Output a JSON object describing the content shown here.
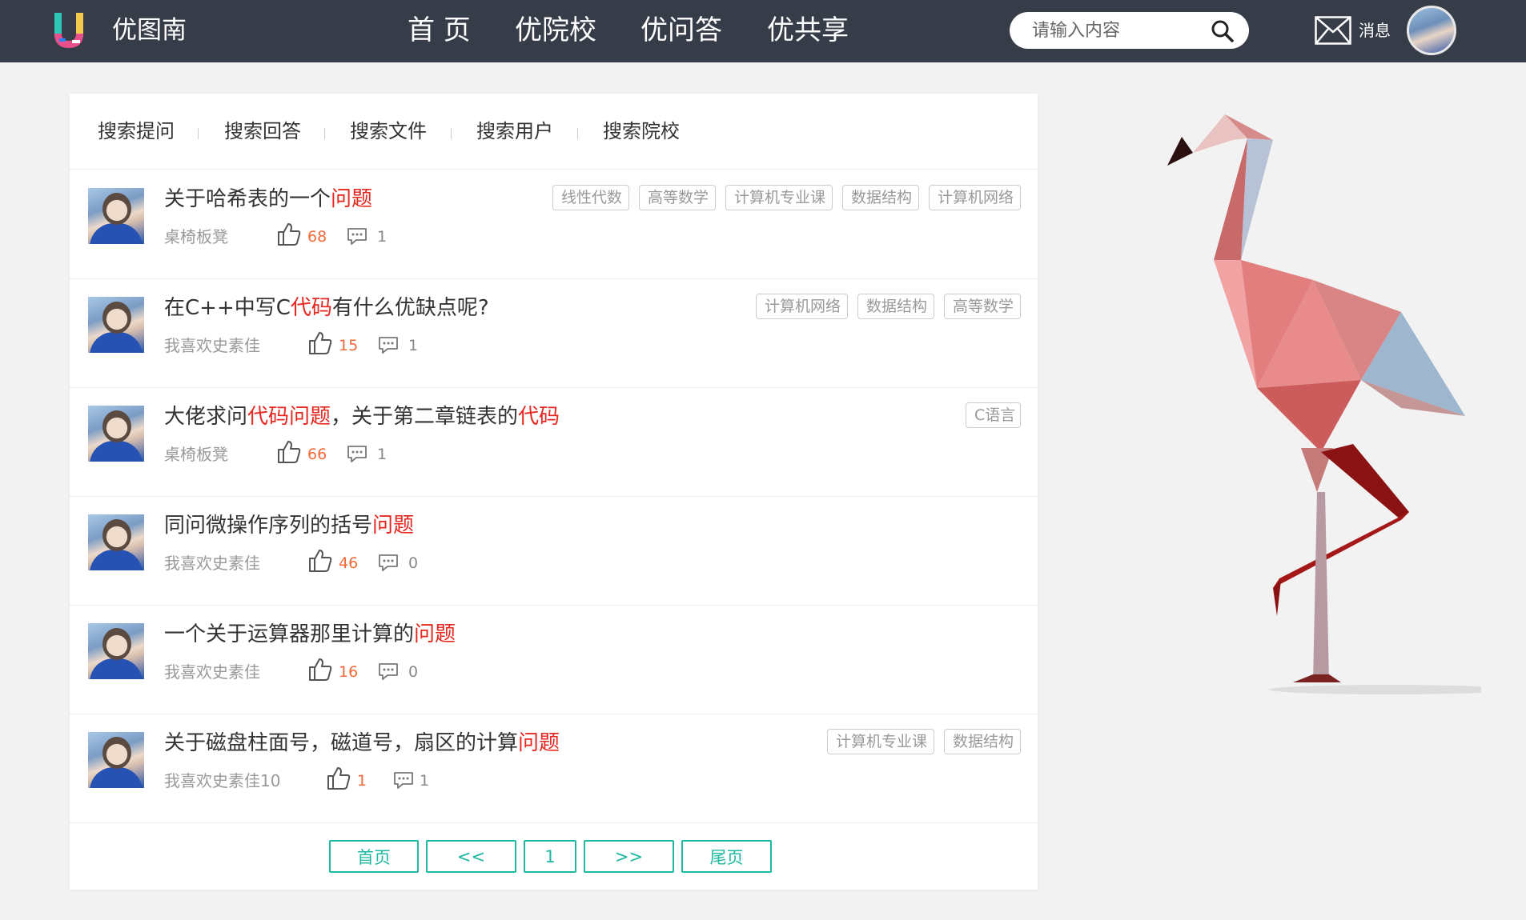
{
  "header": {
    "brand": "优图南",
    "nav": [
      "首 页",
      "优院校",
      "优问答",
      "优共享"
    ],
    "search_placeholder": "请输入内容",
    "messages_label": "消息"
  },
  "search_tabs": [
    "搜索提问",
    "搜索回答",
    "搜索文件",
    "搜索用户",
    "搜索院校"
  ],
  "questions": [
    {
      "title_parts": [
        {
          "t": "关于哈希表的一个",
          "hl": false
        },
        {
          "t": "问题",
          "hl": true
        }
      ],
      "author": "桌椅板凳",
      "likes": "68",
      "comments": "1",
      "tags": [
        "线性代数",
        "高等数学",
        "计算机专业课",
        "数据结构",
        "计算机网络"
      ]
    },
    {
      "title_parts": [
        {
          "t": "在C++中写C",
          "hl": false
        },
        {
          "t": "代码",
          "hl": true
        },
        {
          "t": "有什么优缺点呢?",
          "hl": false
        }
      ],
      "author": "我喜欢史素佳",
      "likes": "15",
      "comments": "1",
      "tags": [
        "计算机网络",
        "数据结构",
        "高等数学"
      ]
    },
    {
      "title_parts": [
        {
          "t": "大佬求问",
          "hl": false
        },
        {
          "t": "代码问题",
          "hl": true
        },
        {
          "t": "，关于第二章链表的",
          "hl": false
        },
        {
          "t": "代码",
          "hl": true
        }
      ],
      "author": "桌椅板凳",
      "likes": "66",
      "comments": "1",
      "tags": [
        "C语言"
      ]
    },
    {
      "title_parts": [
        {
          "t": "同问微操作序列的括号",
          "hl": false
        },
        {
          "t": "问题",
          "hl": true
        }
      ],
      "author": "我喜欢史素佳",
      "likes": "46",
      "comments": "0",
      "tags": []
    },
    {
      "title_parts": [
        {
          "t": "一个关于运算器那里计算的",
          "hl": false
        },
        {
          "t": "问题",
          "hl": true
        }
      ],
      "author": "我喜欢史素佳",
      "likes": "16",
      "comments": "0",
      "tags": []
    },
    {
      "title_parts": [
        {
          "t": "关于磁盘柱面号，磁道号，扇区的计算",
          "hl": false
        },
        {
          "t": "问题",
          "hl": true
        }
      ],
      "author": "我喜欢史素佳10",
      "likes": "1",
      "comments": "1",
      "tags": [
        "计算机专业课",
        "数据结构"
      ]
    }
  ],
  "pagination": [
    "首页",
    "<<",
    "1",
    ">>",
    "尾页"
  ],
  "colors": {
    "header_bg": "#373d48",
    "highlight": "#e6261f",
    "like_count": "#f06a3a",
    "pager_accent": "#1fb8a0"
  },
  "icons": [
    "logo-icon",
    "search-icon",
    "envelope-icon",
    "thumbs-up-icon",
    "comment-icon",
    "flamingo-illustration"
  ]
}
